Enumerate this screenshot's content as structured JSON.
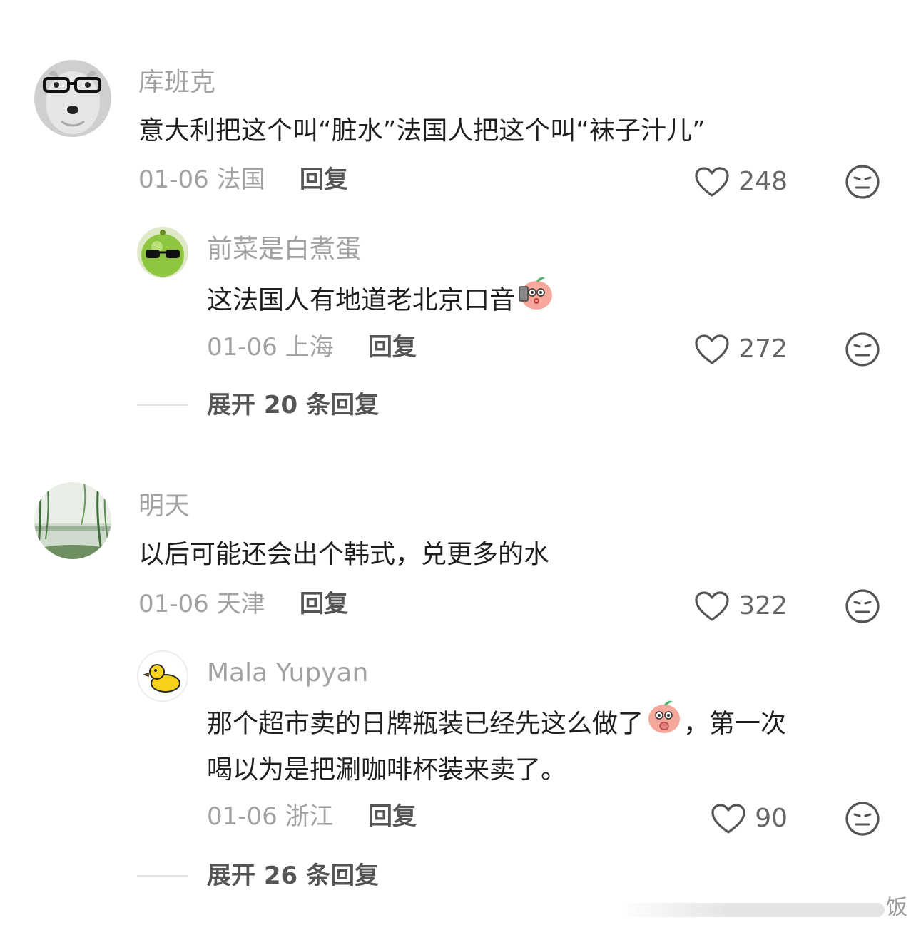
{
  "comments": [
    {
      "user": "库班克",
      "text": "意大利把这个叫“脏水”法国人把这个叫“袜子汁儿”",
      "date": "01-06",
      "location": "法国",
      "reply_label": "回复",
      "likes": "248",
      "avatar_icon": "dog-with-glasses-avatar",
      "reply": {
        "user": "前菜是白煮蛋",
        "text": "这法国人有地道老北京口音",
        "emoji": "peach-face-emoji",
        "date": "01-06",
        "location": "上海",
        "reply_label": "回复",
        "likes": "272",
        "avatar_icon": "green-ball-sunglasses-avatar"
      },
      "expand_label": "展开 20 条回复"
    },
    {
      "user": "明天",
      "text": "以后可能还会出个韩式，兑更多的水",
      "date": "01-06",
      "location": "天津",
      "reply_label": "回复",
      "likes": "322",
      "avatar_icon": "willow-lake-avatar",
      "reply": {
        "user": "Mala Yupyan",
        "text_line1": "那个超市卖的日牌瓶装已经先这么做了",
        "text_line1_end": "，第一次",
        "text_line2": "喝以为是把涮咖啡杯装来卖了。",
        "emoji": "peach-face-emoji",
        "date": "01-06",
        "location": "浙江",
        "reply_label": "回复",
        "likes": "90",
        "avatar_icon": "yellow-duck-avatar"
      },
      "expand_label": "展开 26 条回复"
    }
  ],
  "watermark": "饭",
  "colors": {
    "secondary_text": "#a2a2a2",
    "primary_text": "#1f1f1f",
    "reply_link": "#555555"
  }
}
